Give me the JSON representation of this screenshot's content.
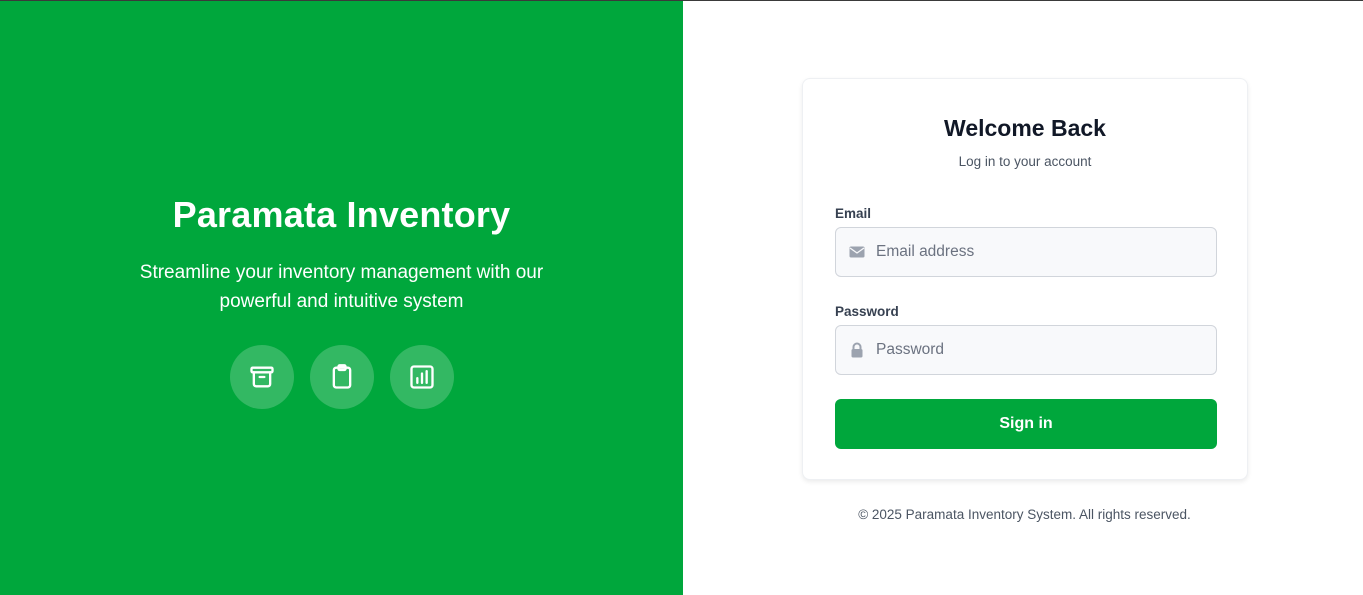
{
  "brand": {
    "title": "Paramata Inventory",
    "tagline": "Streamline your inventory management with our powerful and intuitive system",
    "feature_icons": [
      "archive-icon",
      "clipboard-icon",
      "chart-icon"
    ],
    "color": "#00a73c"
  },
  "login": {
    "title": "Welcome Back",
    "subtitle": "Log in to your account",
    "email_label": "Email",
    "email_placeholder": "Email address",
    "email_value": "",
    "email_icon": "envelope-icon",
    "password_label": "Password",
    "password_placeholder": "Password",
    "password_value": "",
    "password_icon": "lock-icon",
    "submit_label": "Sign in"
  },
  "footer": {
    "text": "© 2025 Paramata Inventory System. All rights reserved."
  }
}
